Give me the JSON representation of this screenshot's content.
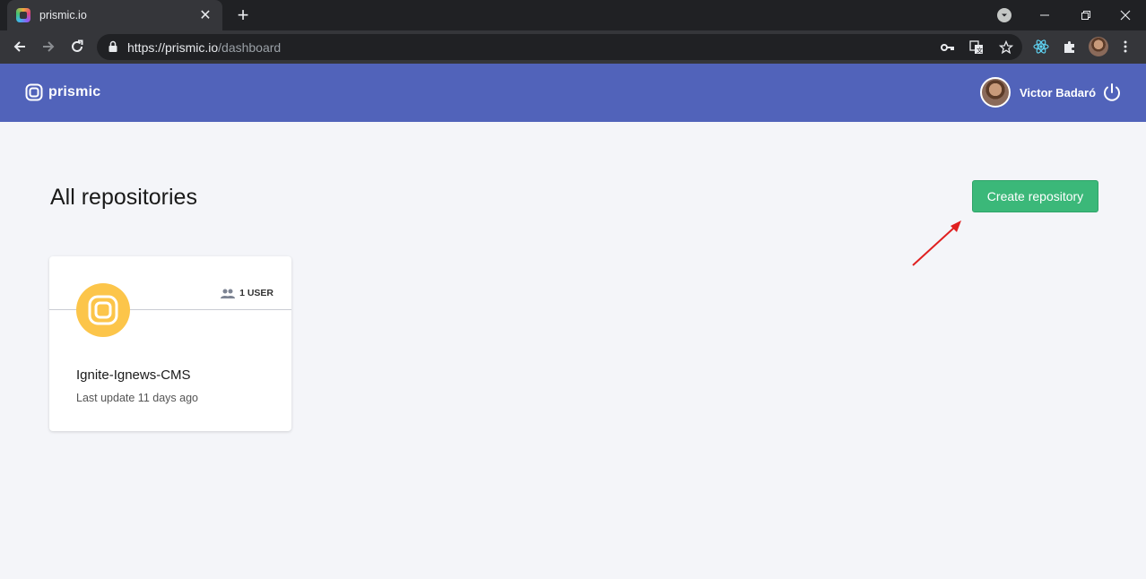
{
  "browser": {
    "tab_title": "prismic.io",
    "tab_close": "✕",
    "new_tab": "+",
    "url_host": "https://prismic.io",
    "url_path": "/dashboard"
  },
  "header": {
    "logo_text": "prismic",
    "user_name": "Victor Badaró"
  },
  "main": {
    "title": "All repositories",
    "create_button": "Create repository"
  },
  "repositories": [
    {
      "users": "1 USER",
      "name": "Ignite-Ignews-CMS",
      "last_update": "Last update 11 days ago"
    }
  ],
  "colors": {
    "header_bg": "#5163ba",
    "create_button_bg": "#3bb879",
    "repo_logo_bg": "#fcc54a",
    "annotation_arrow": "#e02020"
  }
}
